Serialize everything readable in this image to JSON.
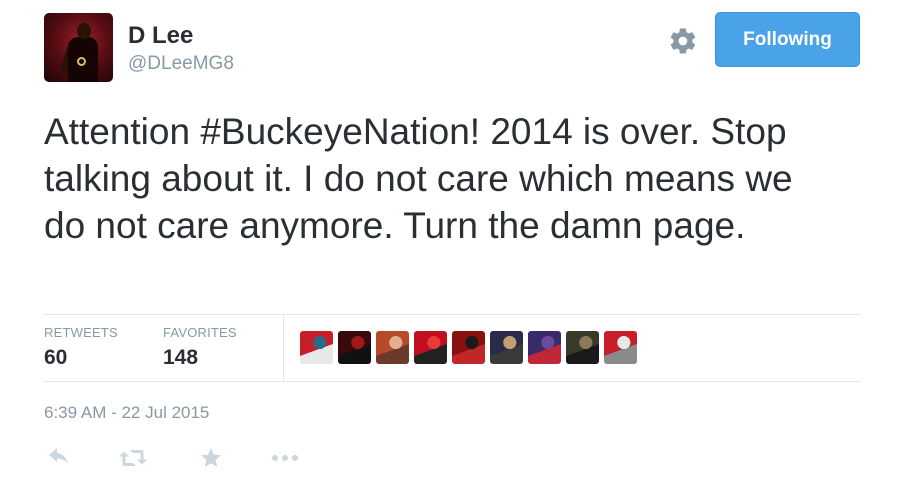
{
  "user": {
    "name": "D Lee",
    "handle": "@DLeeMG8"
  },
  "follow_button": {
    "label": "Following",
    "color": "#4aa3e6"
  },
  "tweet": {
    "text": "Attention #BuckeyeNation! 2014 is over. Stop talking about it. I do not care which means we do not care anymore. Turn the damn page."
  },
  "stats": {
    "retweets_label": "RETWEETS",
    "retweets_value": "60",
    "favorites_label": "FAVORITES",
    "favorites_value": "148"
  },
  "favoriters": [
    {
      "name": "favoriter-1",
      "colors": [
        "#c81e2a",
        "#2a6a8a",
        "#e8e8e8"
      ]
    },
    {
      "name": "favoriter-2",
      "colors": [
        "#3a0a0a",
        "#a01818",
        "#111111"
      ]
    },
    {
      "name": "favoriter-3",
      "colors": [
        "#b84a2a",
        "#e0b090",
        "#6a3a2a"
      ]
    },
    {
      "name": "favoriter-4",
      "colors": [
        "#c01020",
        "#e83a3a",
        "#222222"
      ]
    },
    {
      "name": "favoriter-5",
      "colors": [
        "#8a1010",
        "#1a1a1a",
        "#c02828"
      ]
    },
    {
      "name": "favoriter-6",
      "colors": [
        "#2a2a4a",
        "#c0a070",
        "#3a3a3a"
      ]
    },
    {
      "name": "favoriter-7",
      "colors": [
        "#3a2a6a",
        "#6a4a9a",
        "#c02838"
      ]
    },
    {
      "name": "favoriter-8",
      "colors": [
        "#3a3a2a",
        "#8a7a5a",
        "#1a1a1a"
      ]
    },
    {
      "name": "favoriter-9",
      "colors": [
        "#c81e2a",
        "#e8e8e8",
        "#8a8a8a"
      ]
    }
  ],
  "timestamp": "6:39 AM - 22 Jul 2015",
  "icons": {
    "settings": "gear-icon",
    "reply": "reply-icon",
    "retweet": "retweet-icon",
    "favorite": "star-icon",
    "more": "more-icon"
  },
  "colors": {
    "text": "#292f33",
    "muted": "#8899a6",
    "action_icon": "#ccd6dd",
    "divider": "#e1e8ed"
  }
}
